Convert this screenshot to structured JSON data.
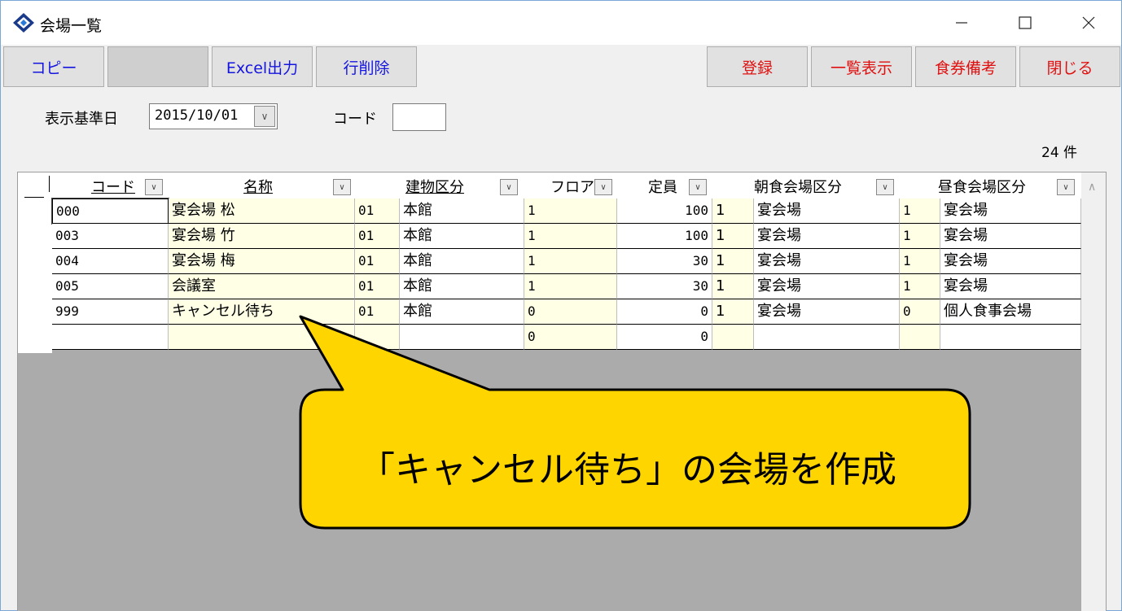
{
  "window": {
    "title": "会場一覧"
  },
  "toolbar": {
    "copy": "コピー",
    "blank": "",
    "excel": "Excel出力",
    "delete_row": "行削除",
    "register": "登録",
    "list_view": "一覧表示",
    "meal_note": "食券備考",
    "close": "閉じる"
  },
  "filter": {
    "date_label": "表示基準日",
    "date_value": "2015/10/01",
    "code_label": "コード",
    "code_value": "",
    "count": "24 件"
  },
  "grid": {
    "headers": [
      "コード",
      "名称",
      "建物区分",
      "フロア",
      "定員",
      "朝食会場区分",
      "昼食会場区分"
    ],
    "rows": [
      [
        "000",
        "宴会場 松",
        "01",
        "本館",
        "1",
        "100",
        "1",
        "宴会場",
        "1",
        "宴会場"
      ],
      [
        "003",
        "宴会場 竹",
        "01",
        "本館",
        "1",
        "100",
        "1",
        "宴会場",
        "1",
        "宴会場"
      ],
      [
        "004",
        "宴会場 梅",
        "01",
        "本館",
        "1",
        "30",
        "1",
        "宴会場",
        "1",
        "宴会場"
      ],
      [
        "005",
        "会議室",
        "01",
        "本館",
        "1",
        "30",
        "1",
        "宴会場",
        "1",
        "宴会場"
      ],
      [
        "999",
        "キャンセル待ち",
        "01",
        "本館",
        "0",
        "0",
        "1",
        "宴会場",
        "0",
        "個人食事会場"
      ],
      [
        "",
        "",
        "",
        "",
        "0",
        "0",
        "",
        "",
        "",
        ""
      ]
    ]
  },
  "callout": {
    "text": "「キャンセル待ち」の会場を作成",
    "fill": "#ffd500"
  },
  "colors": {
    "button_text_blue": "#1515e0",
    "button_text_red": "#e01010",
    "cell_bg": "#ffffe6"
  }
}
